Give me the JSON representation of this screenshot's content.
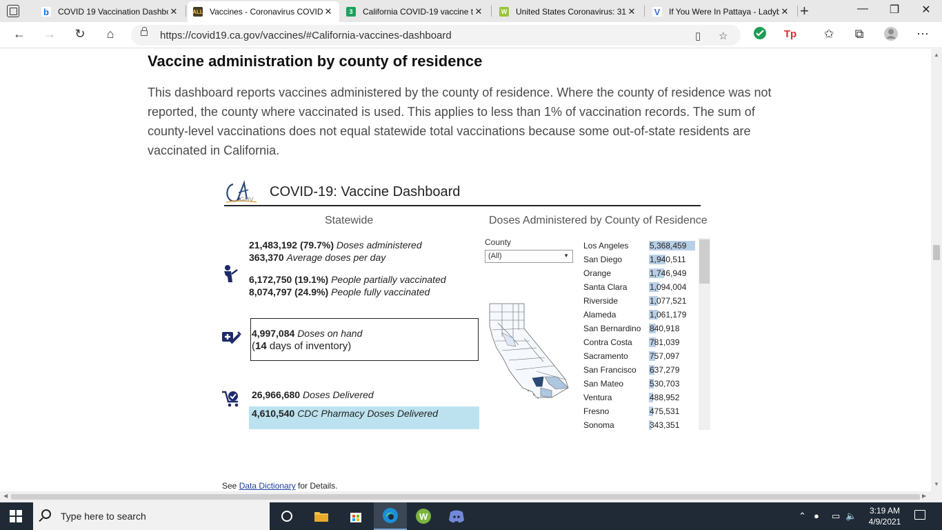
{
  "browser": {
    "tabs": [
      {
        "title": "COVID 19 Vaccination Dashbo",
        "favicon": "bing",
        "active": false
      },
      {
        "title": "Vaccines - Coronavirus COVID",
        "favicon": "all",
        "active": true
      },
      {
        "title": "California COVID-19 vaccine t",
        "favicon": "green-3",
        "active": false
      },
      {
        "title": "United States Coronavirus: 31",
        "favicon": "worldometer",
        "active": false
      },
      {
        "title": "If You Were In Pattaya - Ladyb",
        "favicon": "blue-v",
        "active": false
      }
    ],
    "url": "https://covid19.ca.gov/vaccines/#California-vaccines-dashboard"
  },
  "page": {
    "heading": "Vaccine administration by county of residence",
    "description": "This dashboard reports vaccines administered by the county of residence. Where the county of residence was not reported, the county where vaccinated is used. This applies to less than 1% of vaccination records. The sum of county-level vaccinations does not equal statewide total vaccinations because some out-of-state residents are vaccinated in California.",
    "footnote_prefix": "See ",
    "footnote_link": "Data Dictionary",
    "footnote_suffix": " for Details."
  },
  "dashboard": {
    "logo_text": "CA",
    "logo_sub": ".GOV",
    "title": "COVID-19: Vaccine Dashboard",
    "statewide_heading": "Statewide",
    "county_heading": "Doses Administered by County of Residence",
    "doses_administered_value": "21,483,192 (79.7%)",
    "doses_administered_label": "Doses administered",
    "avg_doses_value": "363,370",
    "avg_doses_label": "Average doses per day",
    "partial_value": "6,172,750 (19.1%)",
    "partial_label": "People partially vaccinated",
    "full_value": "8,074,797 (24.9%)",
    "full_label": "People fully vaccinated",
    "on_hand_value": "4,997,084",
    "on_hand_label": "Doses on hand",
    "inventory_prefix": "(",
    "inventory_days": "14",
    "inventory_suffix": " days of inventory)",
    "delivered_value": "26,966,680",
    "delivered_label": "Doses Delivered",
    "cdc_value": "4,610,540",
    "cdc_label": "CDC Pharmacy Doses Delivered",
    "county_filter_label": "County",
    "county_filter_value": "(All)",
    "counties": [
      {
        "name": "Los Angeles",
        "value": "5,368,459",
        "n": 5368459
      },
      {
        "name": "San Diego",
        "value": "1,940,511",
        "n": 1940511
      },
      {
        "name": "Orange",
        "value": "1,746,949",
        "n": 1746949
      },
      {
        "name": "Santa Clara",
        "value": "1,094,004",
        "n": 1094004
      },
      {
        "name": "Riverside",
        "value": "1,077,521",
        "n": 1077521
      },
      {
        "name": "Alameda",
        "value": "1,061,179",
        "n": 1061179
      },
      {
        "name": "San Bernardino",
        "value": "840,918",
        "n": 840918
      },
      {
        "name": "Contra Costa",
        "value": "781,039",
        "n": 781039
      },
      {
        "name": "Sacramento",
        "value": "757,097",
        "n": 757097
      },
      {
        "name": "San Francisco",
        "value": "637,279",
        "n": 637279
      },
      {
        "name": "San Mateo",
        "value": "530,703",
        "n": 530703
      },
      {
        "name": "Ventura",
        "value": "488,952",
        "n": 488952
      },
      {
        "name": "Fresno",
        "value": "475,531",
        "n": 475531
      },
      {
        "name": "Sonoma",
        "value": "343,351",
        "n": 343351
      }
    ],
    "colors": {
      "bar": "#b9cfe6",
      "highlight": "#bce2ef",
      "map_dark": "#2b4a78",
      "map_light": "#aec6e0"
    }
  },
  "taskbar": {
    "search_placeholder": "Type here to search",
    "time": "3:19 AM",
    "date": "4/9/2021"
  }
}
